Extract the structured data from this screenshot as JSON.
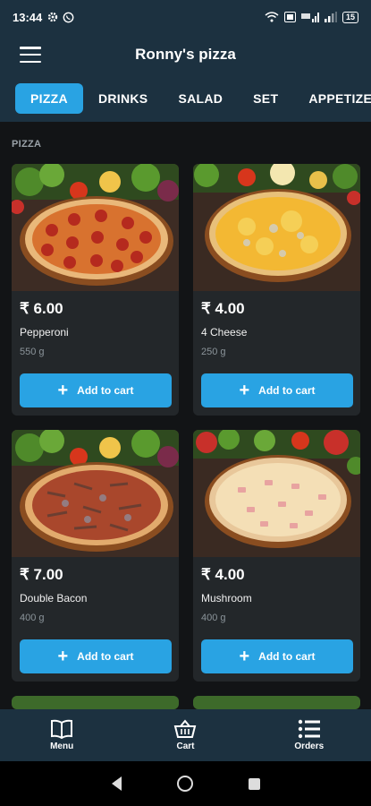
{
  "status": {
    "time": "13:44",
    "battery": "15"
  },
  "header": {
    "title": "Ronny's pizza"
  },
  "tabs": [
    {
      "label": "PIZZA",
      "active": true
    },
    {
      "label": "DRINKS",
      "active": false
    },
    {
      "label": "SALAD",
      "active": false
    },
    {
      "label": "SET",
      "active": false
    },
    {
      "label": "APPETIZERS",
      "active": false
    }
  ],
  "section": {
    "label": "PIZZA"
  },
  "products": [
    {
      "price": "₹ 6.00",
      "name": "Pepperoni",
      "weight": "550 g",
      "button": "Add to cart",
      "image": "pepperoni-pizza"
    },
    {
      "price": "₹ 4.00",
      "name": "4 Cheese",
      "weight": "250 g",
      "button": "Add to cart",
      "image": "cheese-pizza"
    },
    {
      "price": "₹ 7.00",
      "name": "Double Bacon",
      "weight": "400 g",
      "button": "Add to cart",
      "image": "bacon-pizza"
    },
    {
      "price": "₹ 4.00",
      "name": "Mushroom",
      "weight": "400 g",
      "button": "Add to cart",
      "image": "mushroom-pizza"
    }
  ],
  "bottom_nav": [
    {
      "label": "Menu",
      "icon": "book-icon"
    },
    {
      "label": "Cart",
      "icon": "basket-icon"
    },
    {
      "label": "Orders",
      "icon": "list-icon"
    }
  ],
  "colors": {
    "accent": "#29a3e3",
    "header": "#1c3140",
    "card": "#23272a",
    "background": "#121416"
  }
}
